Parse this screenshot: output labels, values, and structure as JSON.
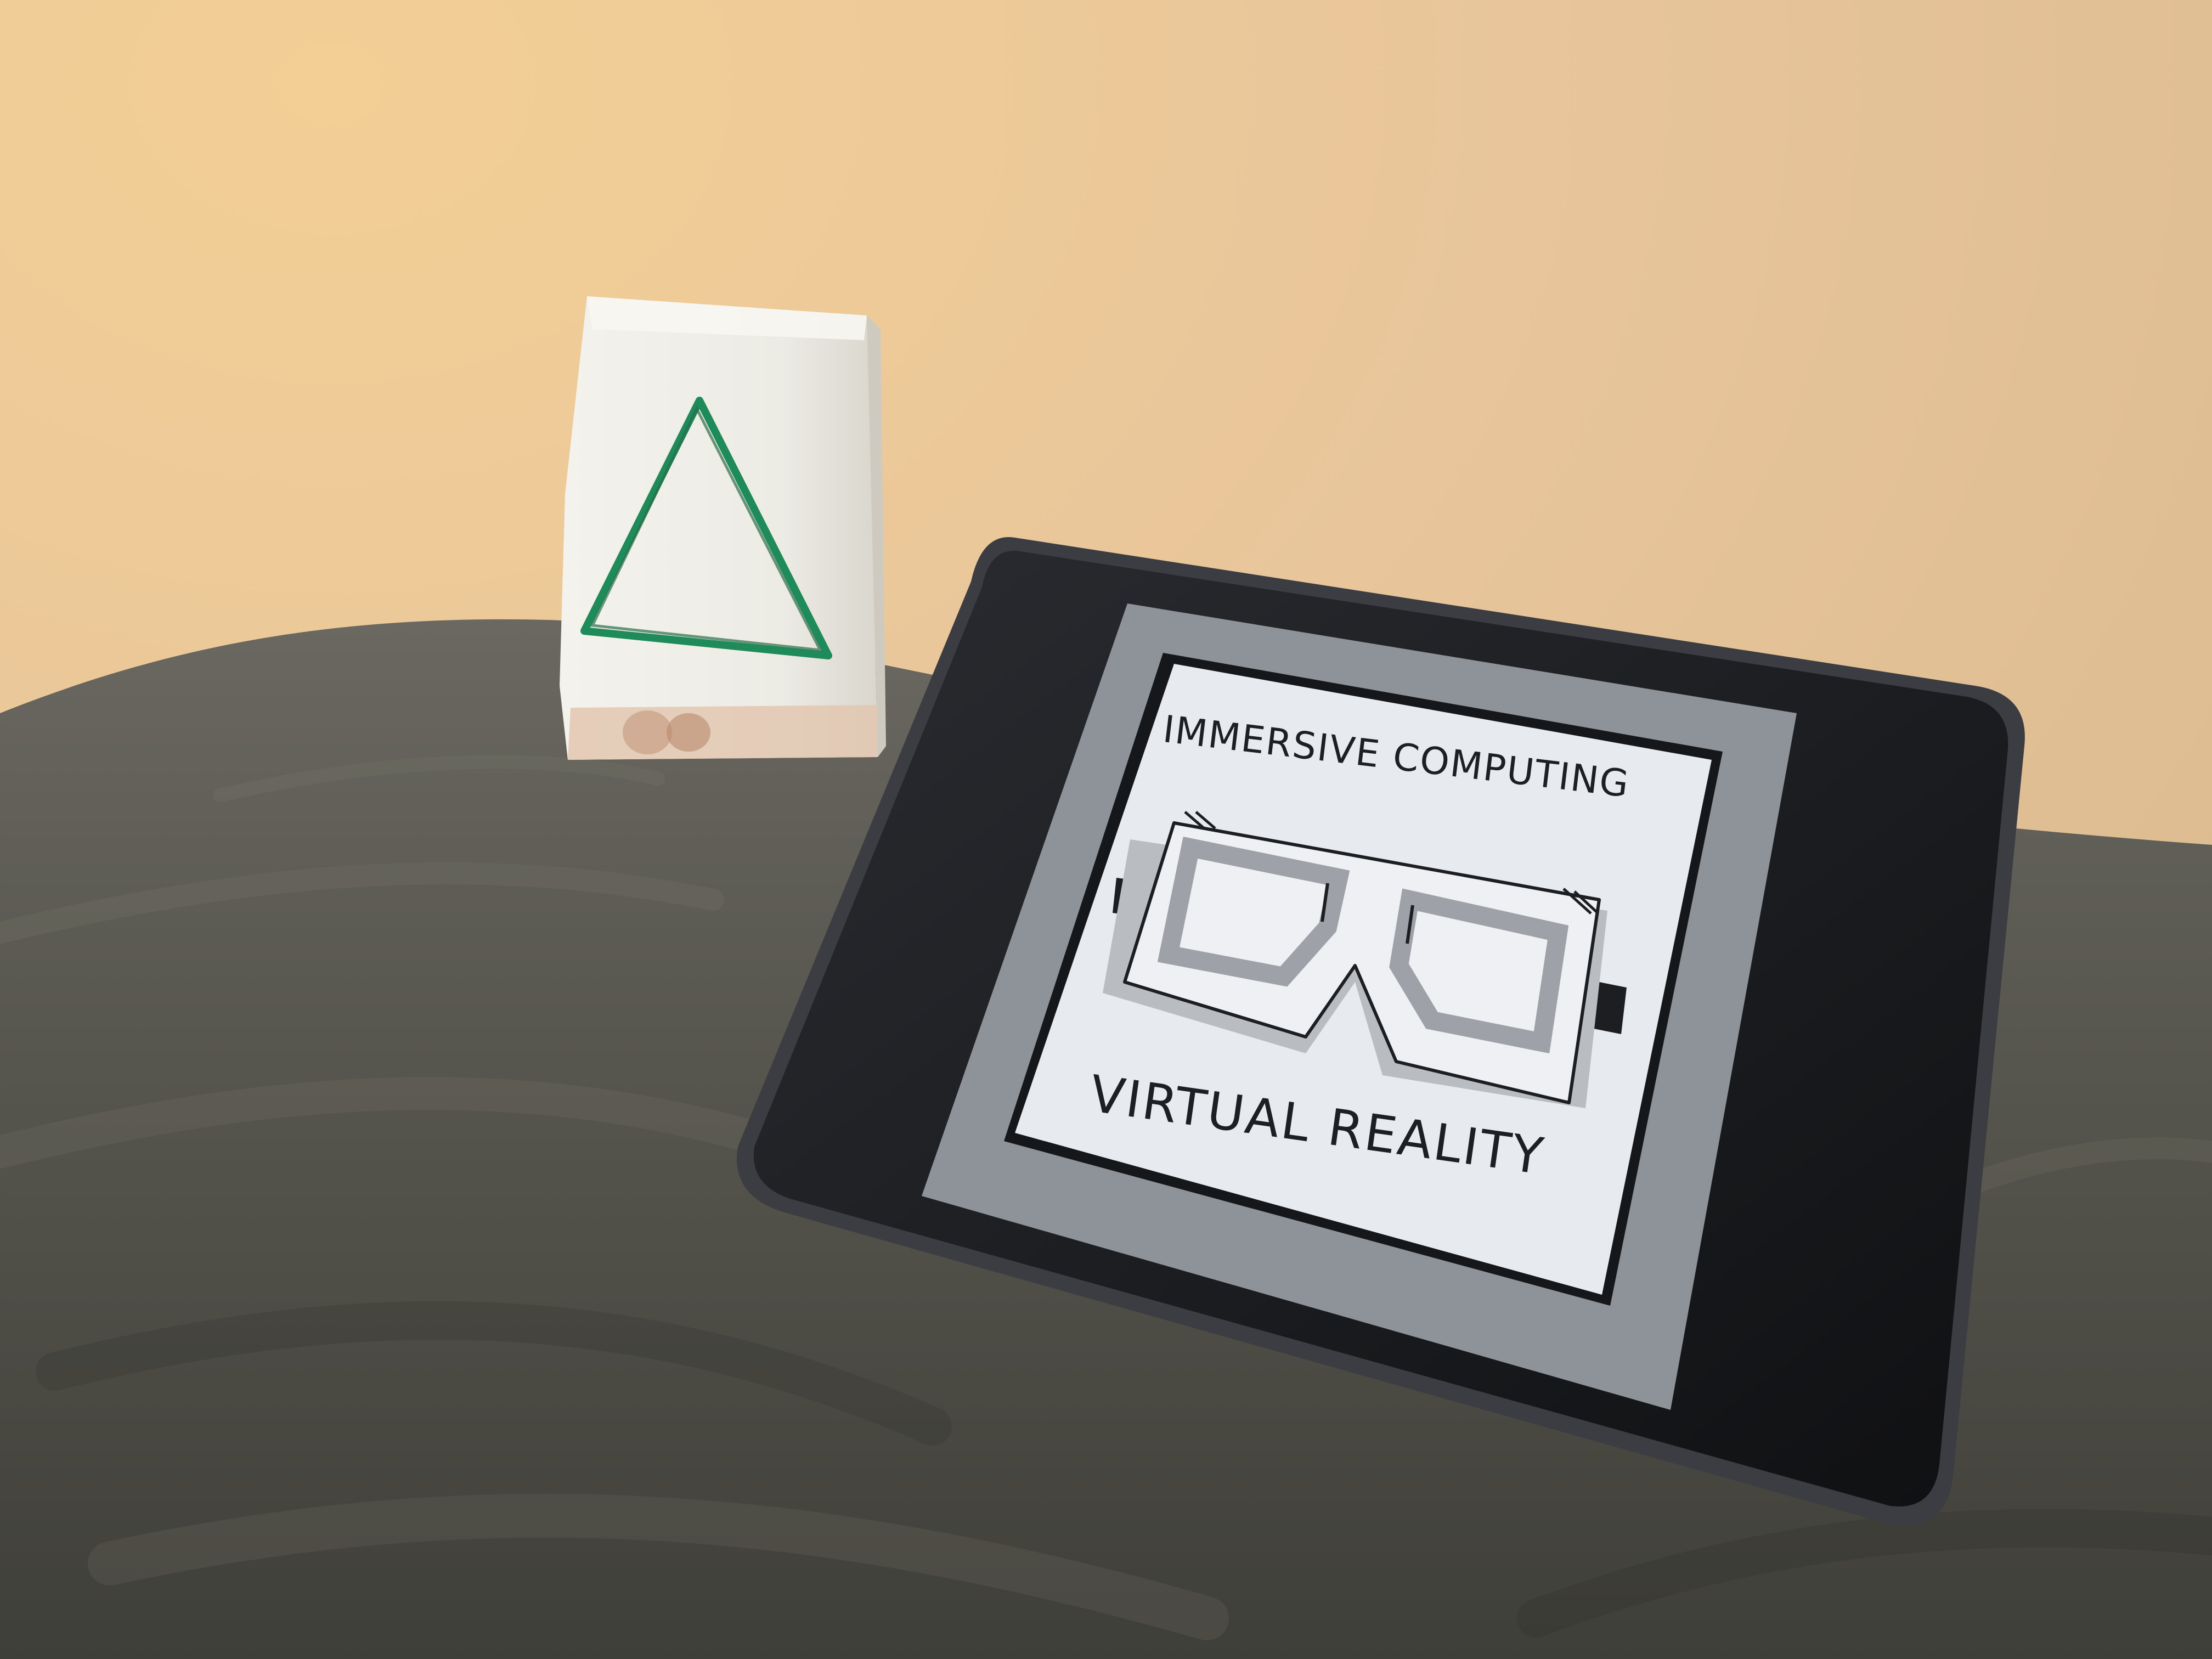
{
  "tablet_screen": {
    "title_top": "IMMERSIVE COMPUTING",
    "title_bottom": "VIRTUAL REALITY",
    "icon": "vr-headset-icon"
  },
  "paper_box": {
    "drawing": "triangle-icon",
    "drawing_color": "#1f8a5a"
  },
  "colors": {
    "wall": "#e9c79a",
    "bedsheet": "#55554c",
    "tablet_frame": "#1a1b1e",
    "screen_border": "#8e9399",
    "screen_paper": "#e7eaee"
  }
}
